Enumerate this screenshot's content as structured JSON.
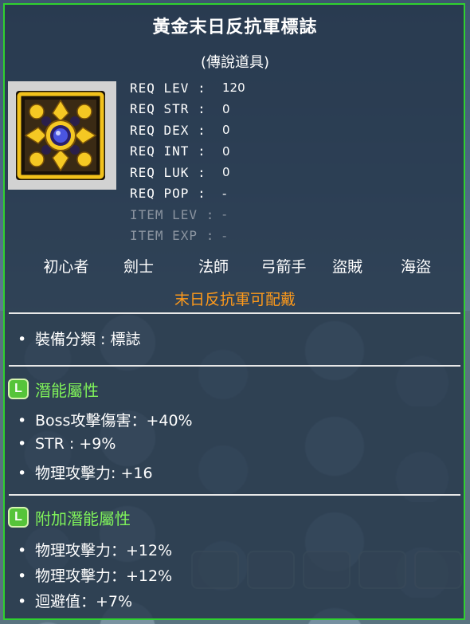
{
  "item": {
    "name": "黃金末日反抗軍標誌",
    "grade": "(傳說道具)"
  },
  "requirements": [
    {
      "label": "REQ LEV :",
      "value": "120",
      "dim": false
    },
    {
      "label": "REQ STR :",
      "value": "0",
      "dim": false
    },
    {
      "label": "REQ DEX :",
      "value": "0",
      "dim": false
    },
    {
      "label": "REQ INT :",
      "value": "0",
      "dim": false
    },
    {
      "label": "REQ LUK :",
      "value": "0",
      "dim": false
    },
    {
      "label": "REQ POP :",
      "value": "-",
      "dim": false
    },
    {
      "label": "ITEM LEV :",
      "value": "-",
      "dim": true
    },
    {
      "label": "ITEM EXP :",
      "value": "-",
      "dim": true
    }
  ],
  "jobs": [
    "初心者",
    "劍士",
    "法師",
    "弓箭手",
    "盜賊",
    "海盜"
  ],
  "restriction": "末日反抗軍可配戴",
  "equip_category": "裝備分類 : 標誌",
  "potential": {
    "badge": "L",
    "title": "潛能屬性",
    "lines": [
      "Boss攻擊傷害：+40%",
      "STR : +9%",
      "物理攻擊力: +16"
    ]
  },
  "bonus_potential": {
    "badge": "L",
    "title": "附加潛能屬性",
    "lines": [
      "物理攻擊力：+12%",
      "物理攻擊力：+12%",
      "迴避值：+7%"
    ]
  },
  "bullet": "•",
  "colors": {
    "frame": "#2fd12f",
    "title": "#ffffff",
    "restriction": "#ff9a1a",
    "potential_title": "#7ff25a",
    "legendary_badge": "#56c43a"
  }
}
